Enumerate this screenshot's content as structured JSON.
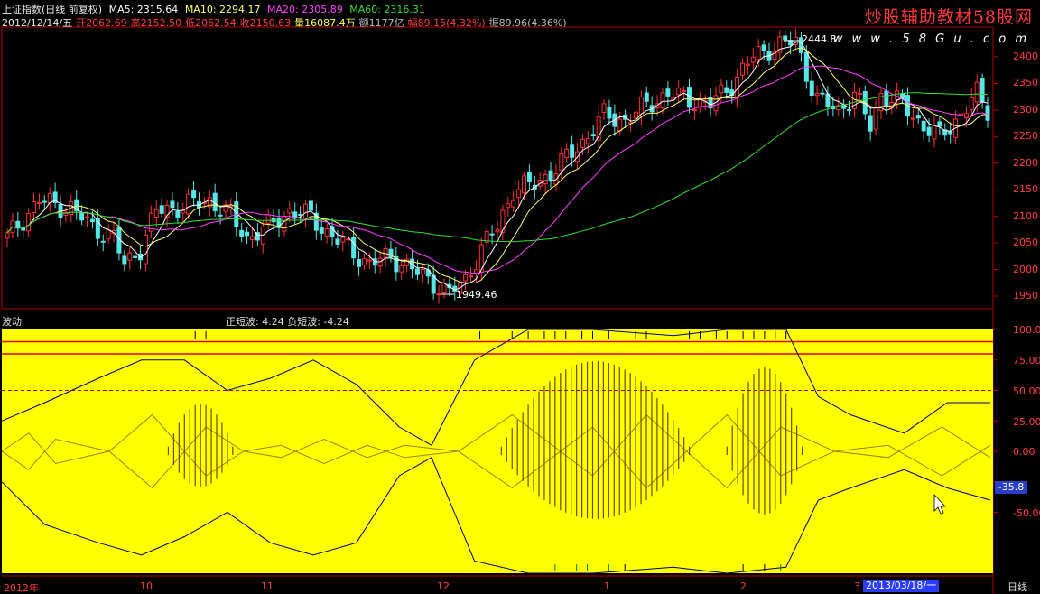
{
  "header": {
    "index_name": "上证指数(日线 前复权)",
    "ma5": "MA5: 2315.64",
    "ma10": "MA10: 2294.17",
    "ma20": "MA20: 2305.89",
    "ma60": "MA60: 2316.31",
    "date": "2012/12/14/五",
    "open": "开2062.69",
    "high": "高2152.50",
    "low": "低2062.54",
    "close": "收2150.63",
    "volume": "量16087.4万",
    "amount": "额1177亿",
    "change": "幅89.15(4.32%)",
    "amplitude": "振89.96(4.36%)"
  },
  "watermark": {
    "title": "炒股辅助教材58股网",
    "url": "w w w . 5 8 G u . c o m"
  },
  "price_axis": [
    "2400",
    "2350",
    "2300",
    "2250",
    "2200",
    "2150",
    "2100",
    "2050",
    "2000",
    "1950"
  ],
  "price_annotations": {
    "high": "2444.8",
    "low": "1949.46"
  },
  "indicator": {
    "name": "波动",
    "values": "正短波: 4.24  负短波: -4.24",
    "axis": [
      "100.0",
      "75.00",
      "50.00",
      "25.00",
      "0.00",
      "-50.00"
    ],
    "current_value": "-35.8"
  },
  "x_axis": [
    "2012年",
    "10",
    "11",
    "12",
    "1",
    "2",
    "3"
  ],
  "current_date": "2013/03/18/一",
  "period": "日线",
  "colors": {
    "bg": "#000000",
    "up": "#ff3030",
    "down": "#54e8e8",
    "panel": "#ffff00",
    "axis": "#b40000"
  }
}
